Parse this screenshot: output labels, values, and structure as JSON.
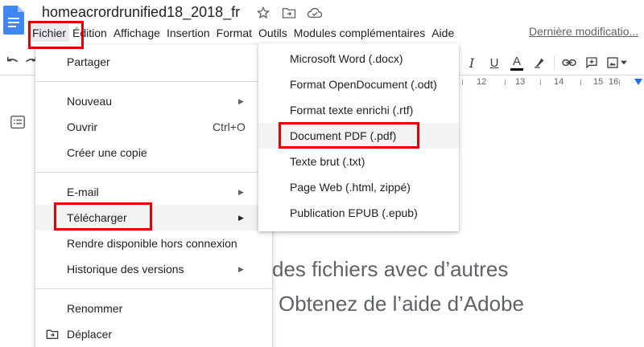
{
  "header": {
    "doc_title": "homeacrordrunified18_2018_fr",
    "star_icon": "star-icon",
    "move_icon": "folder-move-icon",
    "cloud_icon": "cloud-status-icon"
  },
  "menubar": {
    "items": [
      "Fichier",
      "Édition",
      "Affichage",
      "Insertion",
      "Format",
      "Outils",
      "Modules complémentaires",
      "Aide"
    ],
    "last_modification": "Dernière modificatio..."
  },
  "toolbar": {
    "icons": [
      "undo-icon",
      "redo-icon",
      "italic-icon",
      "underline-icon",
      "text-color-icon",
      "highlight-icon",
      "link-icon",
      "comment-icon",
      "image-icon"
    ],
    "italic_label": "I",
    "underline_label": "U",
    "text_color_label": "A"
  },
  "ruler": {
    "numbers": [
      "12",
      "13",
      "14",
      "15",
      "16"
    ]
  },
  "file_menu": {
    "items": {
      "partager": "Partager",
      "nouveau": "Nouveau",
      "ouvrir": "Ouvrir",
      "ouvrir_shortcut": "Ctrl+O",
      "creer_copie": "Créer une copie",
      "email": "E-mail",
      "telecharger": "Télécharger",
      "hors_connexion": "Rendre disponible hors connexion",
      "historique": "Historique des versions",
      "renommer": "Renommer",
      "deplacer": "Déplacer"
    }
  },
  "download_submenu": {
    "items": [
      "Microsoft Word (.docx)",
      "Format OpenDocument (.odt)",
      "Format texte enrichi (.rtf)",
      "Document PDF (.pdf)",
      "Texte brut (.txt)",
      "Page Web (.html, zippé)",
      "Publication EPUB (.epub)"
    ],
    "highlighted": "Document PDF (.pdf)"
  },
  "document": {
    "line1": "des fichiers avec d’autres",
    "line2": "Obtenez de l’aide d’Adobe"
  },
  "colors": {
    "accent_blue": "#1a73e8",
    "doc_icon_blue": "#4285f4",
    "annotation_red": "#e20000",
    "hover_grey": "#f1f3f4"
  }
}
